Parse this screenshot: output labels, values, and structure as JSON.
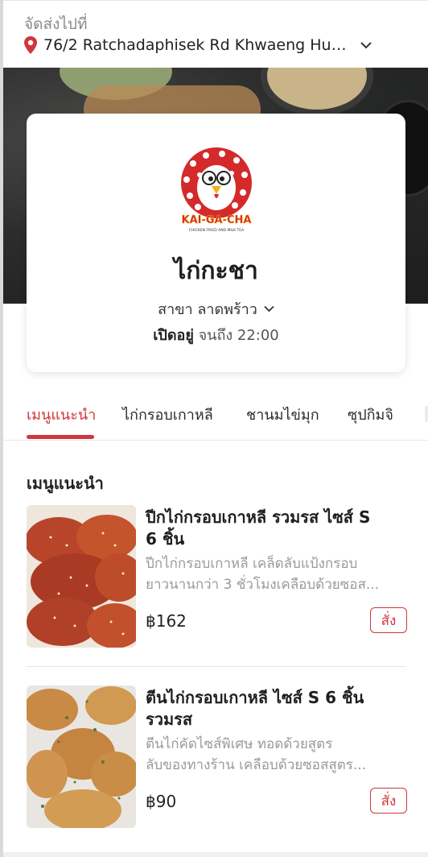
{
  "header": {
    "caption": "จัดส่งไปที่",
    "address": "76/2 Ratchadaphisek Rd Khwaeng Hua..."
  },
  "restaurant": {
    "logo_text": "KAI-GA-CHA",
    "logo_tagline": "CHICKEN FRIED AND MILK TEA",
    "name": "ไก่กะชา",
    "branch": "สาขา ลาดพร้าว",
    "open_label": "เปิดอยู่",
    "hours": "จนถึง 22:00"
  },
  "tabs": [
    {
      "label": "เมนูแนะนำ",
      "active": true
    },
    {
      "label": "ไก่กรอบเกาหลี",
      "active": false
    },
    {
      "label": "ชานมไข่มุก",
      "active": false
    },
    {
      "label": "ซุปกิมจิ",
      "active": false
    }
  ],
  "section": {
    "title": "เมนูแนะนำ"
  },
  "items": [
    {
      "title": "ปีกไก่กรอบเกาหลี รวมรส ไซส์ S 6 ชิ้น",
      "desc_line1": "ปีกไก่กรอบเกาหลี เคล็ดลับแป้งกรอบ",
      "desc_line2": "ยาวนานกว่า 3 ชั่วโมงเคลือบด้วยซอส...",
      "price": "฿162",
      "button": "สั่ง"
    },
    {
      "title": "ตีนไก่กรอบเกาหลี ไซส์ S 6 ชิ้น รวมรส",
      "desc_line1": "ตีนไก่คัดไซส์พิเศษ ทอดด้วยสูตร",
      "desc_line2": "ลับของทางร้าน เคลือบด้วยซอสสูตร...",
      "price": "฿90",
      "button": "สั่ง"
    }
  ],
  "colors": {
    "accent": "#d0363b",
    "text": "#1e1e1e",
    "muted": "#9a9a9a"
  },
  "icons": {
    "location": "location-pin-icon",
    "expand": "chevron-down-icon"
  }
}
